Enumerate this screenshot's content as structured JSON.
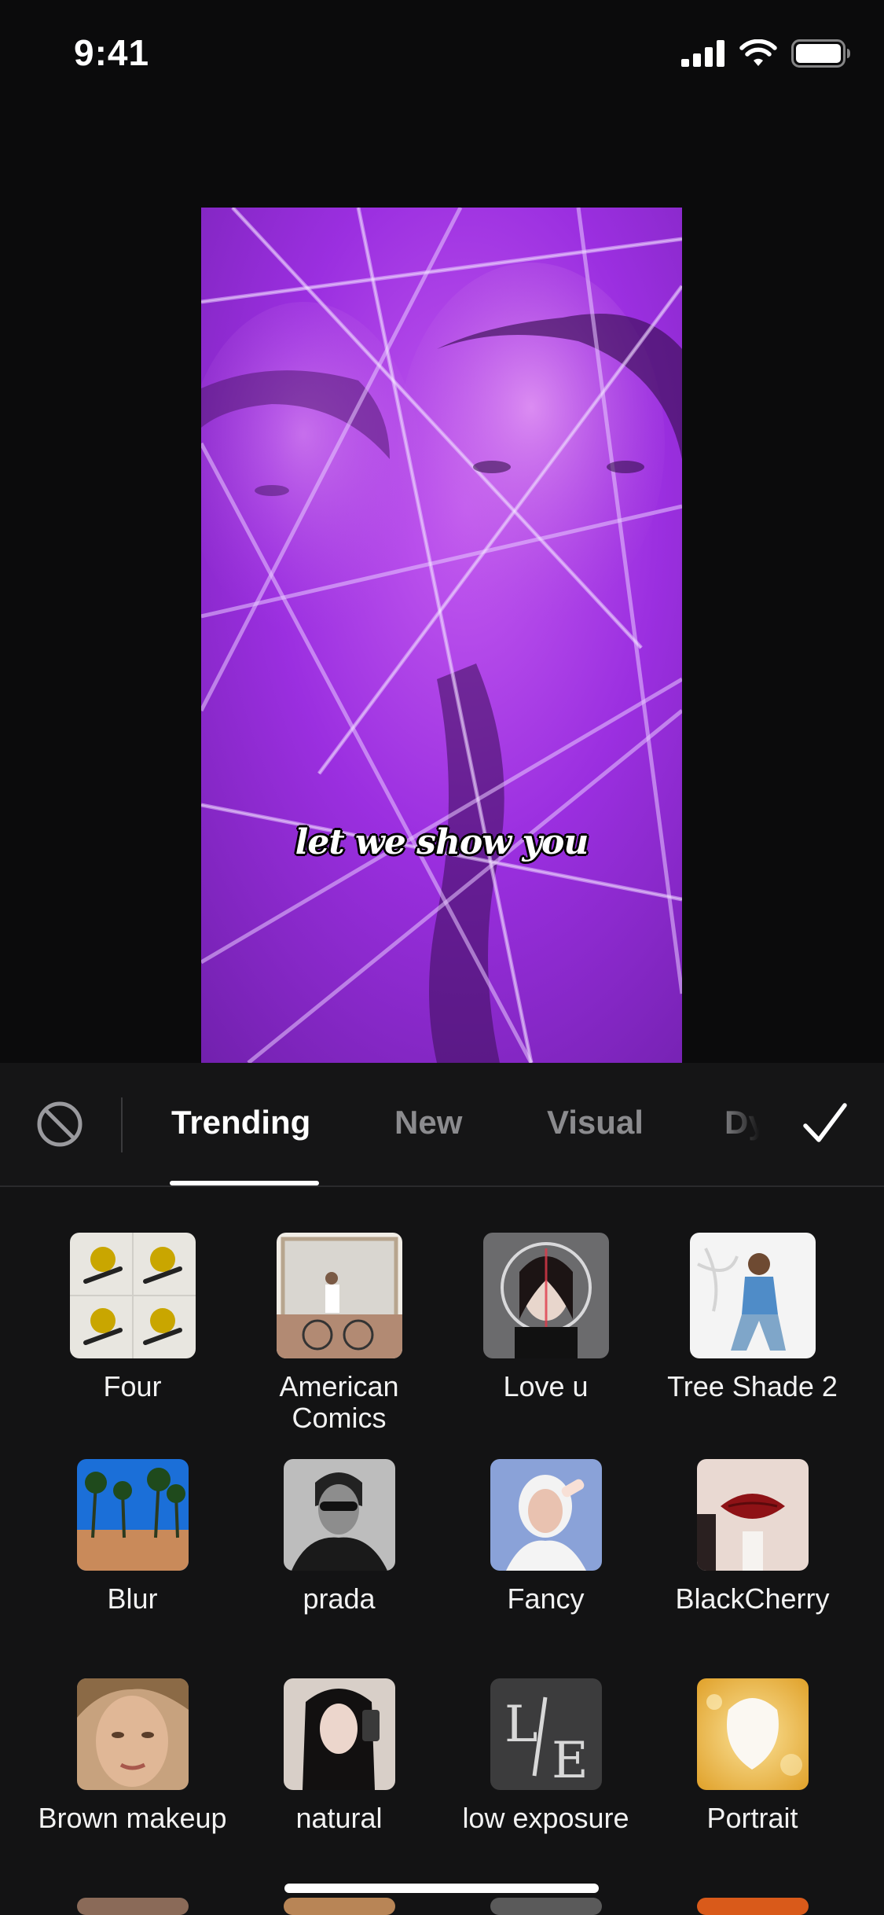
{
  "status_bar": {
    "time": "9:41"
  },
  "preview": {
    "caption": "let we show you"
  },
  "tabs": [
    {
      "label": "Trending",
      "active": true
    },
    {
      "label": "New",
      "active": false
    },
    {
      "label": "Visual",
      "active": false
    },
    {
      "label": "Dy",
      "active": false
    }
  ],
  "effects": [
    {
      "label": "Four"
    },
    {
      "label": "American Comics"
    },
    {
      "label": "Love u"
    },
    {
      "label": "Tree Shade 2"
    },
    {
      "label": "Blur"
    },
    {
      "label": "prada"
    },
    {
      "label": "Fancy"
    },
    {
      "label": "BlackCherry"
    },
    {
      "label": "Brown makeup"
    },
    {
      "label": "natural"
    },
    {
      "label": "low exposure"
    },
    {
      "label": "Portrait"
    }
  ],
  "colors": {
    "background": "#0b0b0c",
    "panel": "#131314",
    "tab_active": "#ffffff",
    "tab_inactive": "#8b8b8e",
    "preview_accent": "#a63be8"
  }
}
